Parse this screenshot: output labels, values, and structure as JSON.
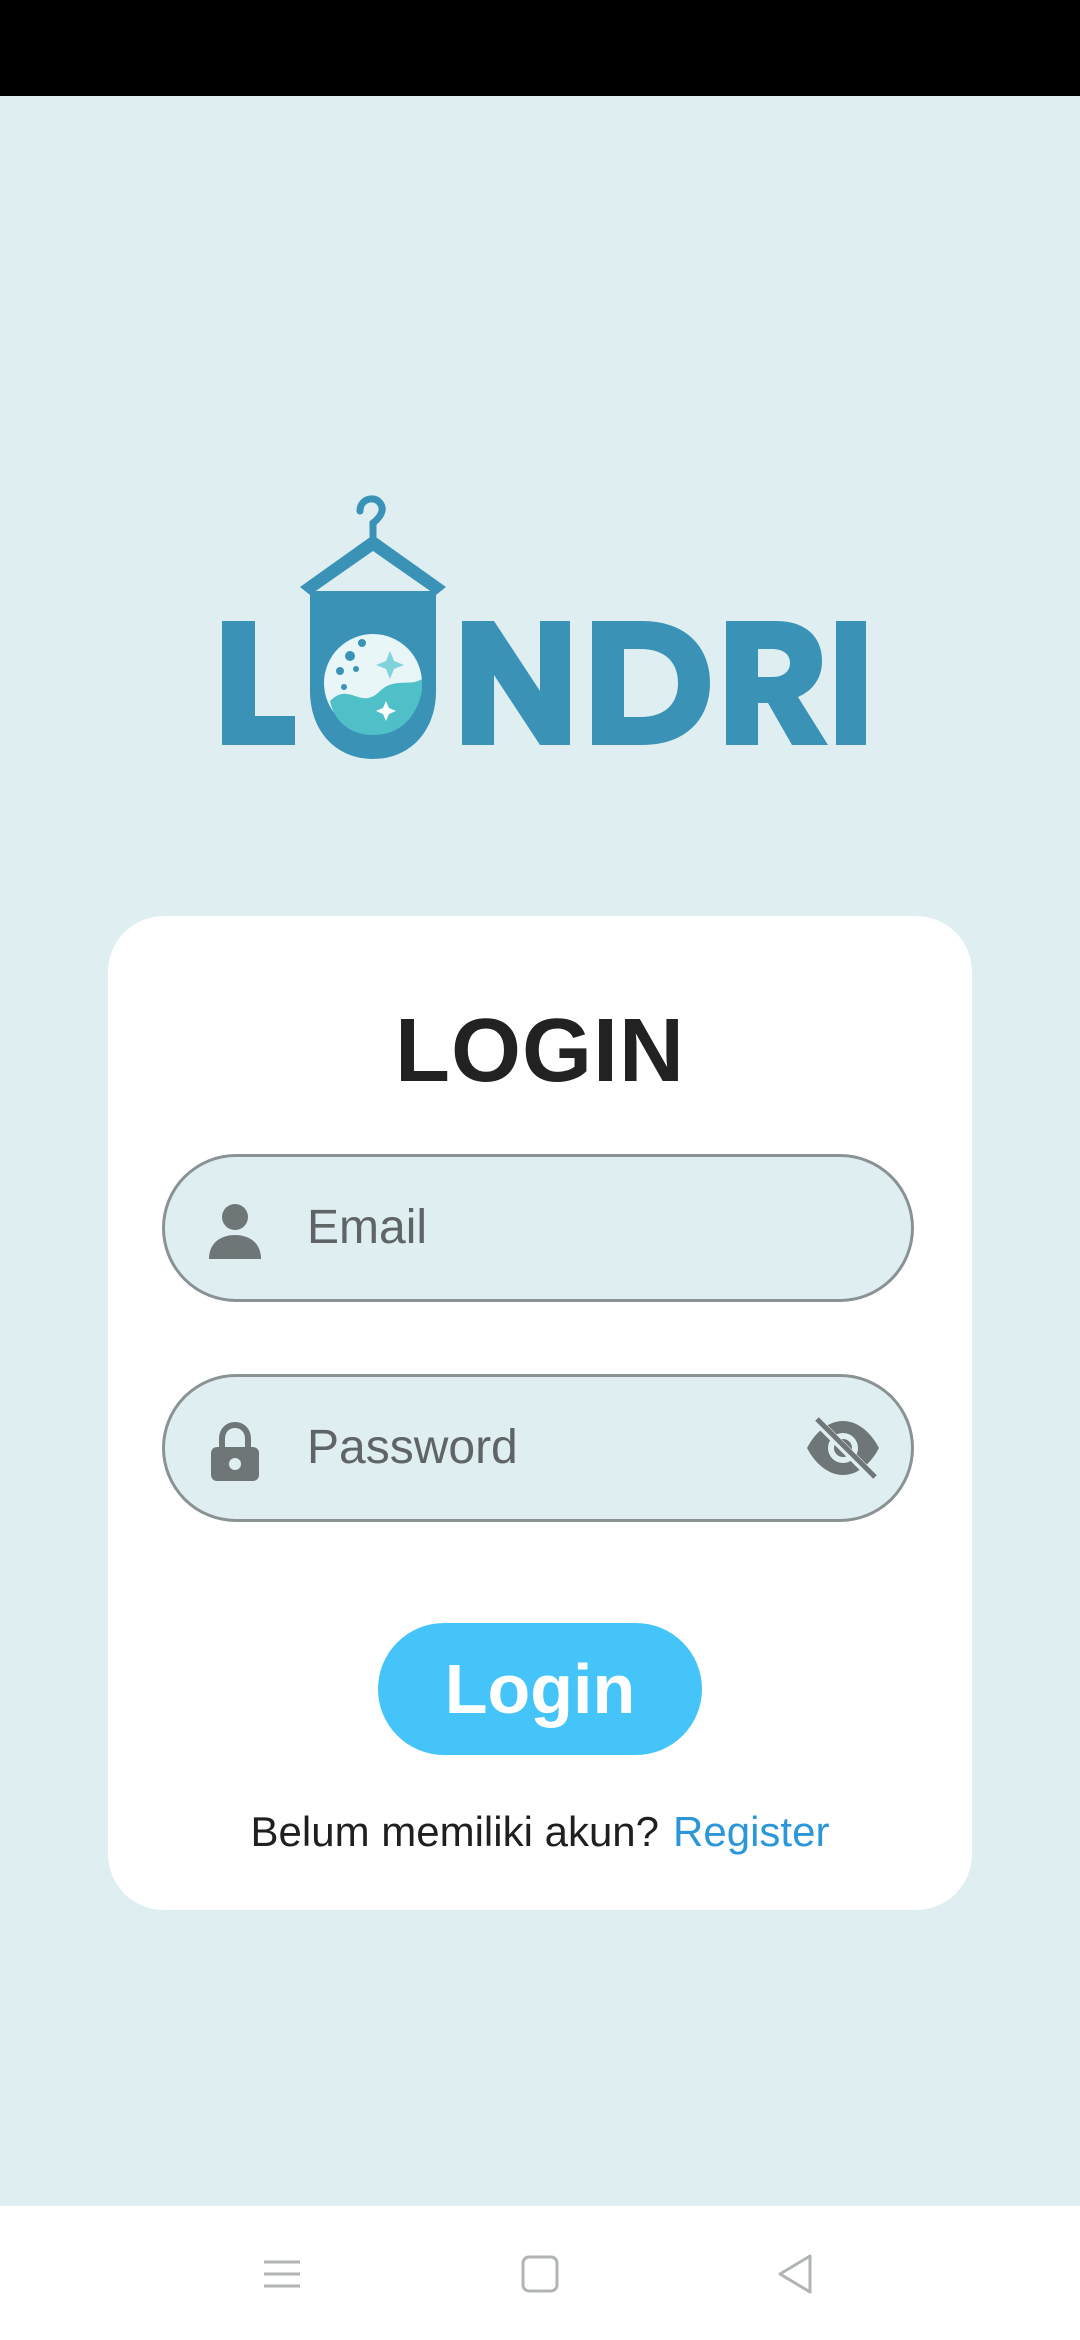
{
  "app": {
    "logo_text": "LONDRI",
    "brand_color": "#3a93b6"
  },
  "login_card": {
    "title": "LOGIN",
    "email_field": {
      "placeholder": "Email",
      "icon": "person-icon"
    },
    "password_field": {
      "placeholder": "Password",
      "icon": "lock-icon",
      "toggle_icon": "eye-off-icon"
    },
    "login_button_label": "Login",
    "register_prompt": "Belum memiliki akun?",
    "register_link": "Register",
    "accent_color": "#45c4fa",
    "link_color": "#2b96d8"
  },
  "nav_bar": {
    "buttons": [
      "menu-icon",
      "home-square-icon",
      "back-triangle-icon"
    ]
  },
  "colors": {
    "background": "#dfeff1",
    "card": "#ffffff",
    "status_bar": "#000000"
  }
}
